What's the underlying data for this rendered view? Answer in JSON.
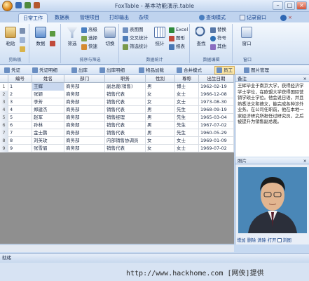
{
  "window": {
    "title": "FoxTable - 基本功能演示.table"
  },
  "tabs": [
    {
      "label": "日常工作",
      "active": true
    },
    {
      "label": "数据表"
    },
    {
      "label": "管理项目"
    },
    {
      "label": "打印输出"
    },
    {
      "label": "杂项"
    }
  ],
  "right_tools": {
    "query_mode": "查询模式",
    "record_window": "记录窗口"
  },
  "ribbon": {
    "clipboard": {
      "label": "剪贴板",
      "paste": "粘贴"
    },
    "data": {
      "label": "",
      "data": "数据"
    },
    "sort_filter": {
      "label": "排序与筛选",
      "filter": "筛选",
      "advanced": "高级",
      "select": "选择",
      "switch": "切换",
      "quick": "快速"
    },
    "stats": {
      "label": "数据统计",
      "table_chart": "表图图",
      "cross_stat": "交叉统计",
      "quick_stat": "筛选统计",
      "excel": "Excel",
      "chart": "图形",
      "report": "报表",
      "stat": "统计"
    },
    "find": {
      "label": "数据编辑",
      "find": "查找",
      "replace": "替换",
      "symbol": "符号",
      "other": "其他"
    },
    "window": {
      "label": "窗口",
      "window": "窗口"
    }
  },
  "toolbar2": [
    {
      "label": "凭证"
    },
    {
      "label": "凭证明细"
    },
    {
      "label": "出库"
    },
    {
      "label": "出库明细"
    },
    {
      "label": "物品加载"
    },
    {
      "label": "合并模式"
    },
    {
      "label": "员工",
      "active": true
    },
    {
      "label": "图片管理"
    }
  ],
  "grid": {
    "columns": [
      "",
      "编号",
      "姓名",
      "部门",
      "职务",
      "性别",
      "尊称",
      "出生日期"
    ],
    "rows": [
      {
        "n": "1",
        "id": "1",
        "name": "王辉",
        "dept": "商务部",
        "title": "副总裁(销售)",
        "sex": "男",
        "hon": "博士",
        "dob": "1962-02-19"
      },
      {
        "n": "2",
        "id": "2",
        "name": "张颖",
        "dept": "商务部",
        "title": "销售代表",
        "sex": "女",
        "hon": "女士",
        "dob": "1966-12-08"
      },
      {
        "n": "3",
        "id": "3",
        "name": "李芳",
        "dept": "商务部",
        "title": "销售代表",
        "sex": "女",
        "hon": "女士",
        "dob": "1973-08-30"
      },
      {
        "n": "4",
        "id": "4",
        "name": "郑建杰",
        "dept": "商务部",
        "title": "销售代表",
        "sex": "男",
        "hon": "先生",
        "dob": "1968-09-19"
      },
      {
        "n": "5",
        "id": "5",
        "name": "赵军",
        "dept": "商务部",
        "title": "销售经理",
        "sex": "男",
        "hon": "先生",
        "dob": "1965-03-04"
      },
      {
        "n": "6",
        "id": "6",
        "name": "孙林",
        "dept": "商务部",
        "title": "销售代表",
        "sex": "男",
        "hon": "先生",
        "dob": "1967-07-02"
      },
      {
        "n": "7",
        "id": "7",
        "name": "金士鹏",
        "dept": "商务部",
        "title": "销售代表",
        "sex": "男",
        "hon": "先生",
        "dob": "1960-05-29"
      },
      {
        "n": "8",
        "id": "8",
        "name": "刘英玫",
        "dept": "商务部",
        "title": "内部销售协调员",
        "sex": "女",
        "hon": "女士",
        "dob": "1969-01-09"
      },
      {
        "n": "9",
        "id": "9",
        "name": "张雪眉",
        "dept": "商务部",
        "title": "销售代表",
        "sex": "女",
        "hon": "女士",
        "dob": "1969-07-02"
      }
    ]
  },
  "remark_panel": {
    "title": "备注",
    "text": "王辉毕业于南京大学，获得经济学学士学位，在欧盟大学获得国际营销学硕士学位。他会说日语，并且熟悉法文和德文，能完成各种涉外业务。在公司任职前，他在本地一家经济研究所担任过研究员，之后被提升为销售副总裁。"
  },
  "photo_panel": {
    "title": "照片",
    "add": "增加",
    "delete": "删除",
    "clear": "清除",
    "open": "打开",
    "flow": "浏图"
  },
  "status": {
    "text": "就绪"
  },
  "watermark": "http://www.hackhome.com [网侠]提供",
  "colors": {
    "accent": "#15428b",
    "ribbon": "#dbe7f6",
    "selected": "#c9d8ef"
  }
}
